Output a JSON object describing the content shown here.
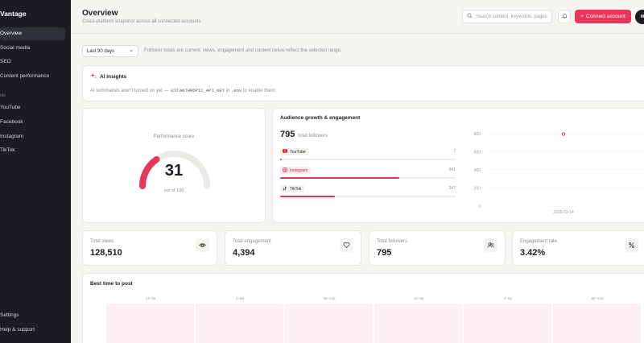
{
  "app": {
    "name": "Vantage"
  },
  "sidebar": {
    "items": [
      {
        "label": "Overview"
      },
      {
        "label": "Social media"
      },
      {
        "label": "SEO"
      },
      {
        "label": "Content performance"
      }
    ],
    "section_label": "nts",
    "accounts": [
      {
        "label": "YouTube"
      },
      {
        "label": "Facebook"
      },
      {
        "label": "Instagram"
      },
      {
        "label": "TikTok"
      }
    ],
    "footer": [
      {
        "label": "Settings"
      },
      {
        "label": "Help & support"
      }
    ]
  },
  "header": {
    "title": "Overview",
    "subtitle": "Cross-platform snapshot across all connected accounts",
    "search_placeholder": "Search content, keywords, pages",
    "connect_label": "Connect account",
    "avatar_initial": "M"
  },
  "filter": {
    "range_value": "Last 90 days",
    "note": "Follower totals are current; views, engagement and content below reflect the selected range."
  },
  "ai_insights": {
    "title": "AI Insights",
    "text_before": "AI summaries aren't turned on yet — add ",
    "key_name": "ANTHROPIC_API_KEY",
    "text_middle": " in ",
    "env_name": ".env",
    "text_after": " to enable them."
  },
  "performance": {
    "label": "Performance score",
    "score": 31,
    "score_text": "31",
    "max_text": "out of 100",
    "max": 100
  },
  "audience": {
    "title": "Audience growth & engagement",
    "total_value": "795",
    "total_label": "total followers",
    "platforms": [
      {
        "name": "YouTube",
        "count": "7",
        "value": 7
      },
      {
        "name": "Instagram",
        "count": "541",
        "value": 541
      },
      {
        "name": "TikTok",
        "count": "247",
        "value": 247
      }
    ],
    "accent_color": "#e0345a"
  },
  "chart_data": {
    "type": "scatter",
    "x": [
      "2026-03-14"
    ],
    "series": [
      {
        "values": [
          795
        ]
      }
    ],
    "y_ticks": [
      "800",
      "600",
      "400",
      "200",
      "0"
    ],
    "x_tick_labels": [
      "2026-03-14"
    ],
    "ylim": [
      0,
      800
    ],
    "grid": true
  },
  "stats": [
    {
      "label": "Total views",
      "value": "128,510",
      "icon": "eye-icon"
    },
    {
      "label": "Total engagement",
      "value": "4,394",
      "icon": "heart-icon"
    },
    {
      "label": "Total followers",
      "value": "795",
      "icon": "users-icon"
    },
    {
      "label": "Engagement rate",
      "value": "3.42%",
      "icon": "percent-icon"
    }
  ],
  "best_time": {
    "title": "Best time to post",
    "columns": [
      "12–4a",
      "4–8a",
      "8a–12p",
      "12–4p",
      "4–8p",
      "8p–12a"
    ]
  }
}
